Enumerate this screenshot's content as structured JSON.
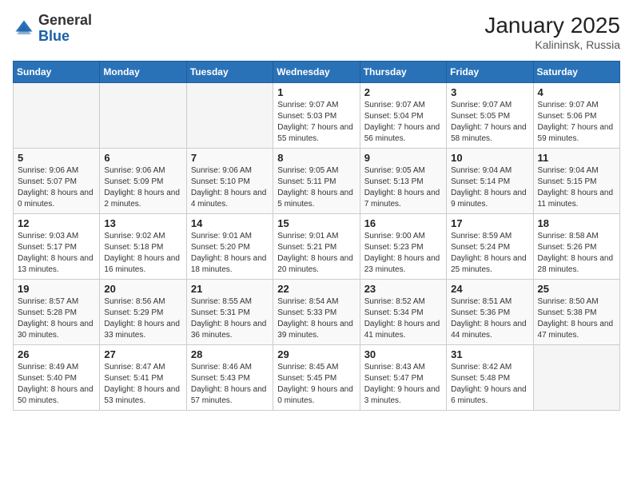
{
  "header": {
    "logo_general": "General",
    "logo_blue": "Blue",
    "month": "January 2025",
    "location": "Kalininsk, Russia"
  },
  "days_of_week": [
    "Sunday",
    "Monday",
    "Tuesday",
    "Wednesday",
    "Thursday",
    "Friday",
    "Saturday"
  ],
  "weeks": [
    [
      {
        "day": "",
        "info": ""
      },
      {
        "day": "",
        "info": ""
      },
      {
        "day": "",
        "info": ""
      },
      {
        "day": "1",
        "info": "Sunrise: 9:07 AM\nSunset: 5:03 PM\nDaylight: 7 hours and 55 minutes."
      },
      {
        "day": "2",
        "info": "Sunrise: 9:07 AM\nSunset: 5:04 PM\nDaylight: 7 hours and 56 minutes."
      },
      {
        "day": "3",
        "info": "Sunrise: 9:07 AM\nSunset: 5:05 PM\nDaylight: 7 hours and 58 minutes."
      },
      {
        "day": "4",
        "info": "Sunrise: 9:07 AM\nSunset: 5:06 PM\nDaylight: 7 hours and 59 minutes."
      }
    ],
    [
      {
        "day": "5",
        "info": "Sunrise: 9:06 AM\nSunset: 5:07 PM\nDaylight: 8 hours and 0 minutes."
      },
      {
        "day": "6",
        "info": "Sunrise: 9:06 AM\nSunset: 5:09 PM\nDaylight: 8 hours and 2 minutes."
      },
      {
        "day": "7",
        "info": "Sunrise: 9:06 AM\nSunset: 5:10 PM\nDaylight: 8 hours and 4 minutes."
      },
      {
        "day": "8",
        "info": "Sunrise: 9:05 AM\nSunset: 5:11 PM\nDaylight: 8 hours and 5 minutes."
      },
      {
        "day": "9",
        "info": "Sunrise: 9:05 AM\nSunset: 5:13 PM\nDaylight: 8 hours and 7 minutes."
      },
      {
        "day": "10",
        "info": "Sunrise: 9:04 AM\nSunset: 5:14 PM\nDaylight: 8 hours and 9 minutes."
      },
      {
        "day": "11",
        "info": "Sunrise: 9:04 AM\nSunset: 5:15 PM\nDaylight: 8 hours and 11 minutes."
      }
    ],
    [
      {
        "day": "12",
        "info": "Sunrise: 9:03 AM\nSunset: 5:17 PM\nDaylight: 8 hours and 13 minutes."
      },
      {
        "day": "13",
        "info": "Sunrise: 9:02 AM\nSunset: 5:18 PM\nDaylight: 8 hours and 16 minutes."
      },
      {
        "day": "14",
        "info": "Sunrise: 9:01 AM\nSunset: 5:20 PM\nDaylight: 8 hours and 18 minutes."
      },
      {
        "day": "15",
        "info": "Sunrise: 9:01 AM\nSunset: 5:21 PM\nDaylight: 8 hours and 20 minutes."
      },
      {
        "day": "16",
        "info": "Sunrise: 9:00 AM\nSunset: 5:23 PM\nDaylight: 8 hours and 23 minutes."
      },
      {
        "day": "17",
        "info": "Sunrise: 8:59 AM\nSunset: 5:24 PM\nDaylight: 8 hours and 25 minutes."
      },
      {
        "day": "18",
        "info": "Sunrise: 8:58 AM\nSunset: 5:26 PM\nDaylight: 8 hours and 28 minutes."
      }
    ],
    [
      {
        "day": "19",
        "info": "Sunrise: 8:57 AM\nSunset: 5:28 PM\nDaylight: 8 hours and 30 minutes."
      },
      {
        "day": "20",
        "info": "Sunrise: 8:56 AM\nSunset: 5:29 PM\nDaylight: 8 hours and 33 minutes."
      },
      {
        "day": "21",
        "info": "Sunrise: 8:55 AM\nSunset: 5:31 PM\nDaylight: 8 hours and 36 minutes."
      },
      {
        "day": "22",
        "info": "Sunrise: 8:54 AM\nSunset: 5:33 PM\nDaylight: 8 hours and 39 minutes."
      },
      {
        "day": "23",
        "info": "Sunrise: 8:52 AM\nSunset: 5:34 PM\nDaylight: 8 hours and 41 minutes."
      },
      {
        "day": "24",
        "info": "Sunrise: 8:51 AM\nSunset: 5:36 PM\nDaylight: 8 hours and 44 minutes."
      },
      {
        "day": "25",
        "info": "Sunrise: 8:50 AM\nSunset: 5:38 PM\nDaylight: 8 hours and 47 minutes."
      }
    ],
    [
      {
        "day": "26",
        "info": "Sunrise: 8:49 AM\nSunset: 5:40 PM\nDaylight: 8 hours and 50 minutes."
      },
      {
        "day": "27",
        "info": "Sunrise: 8:47 AM\nSunset: 5:41 PM\nDaylight: 8 hours and 53 minutes."
      },
      {
        "day": "28",
        "info": "Sunrise: 8:46 AM\nSunset: 5:43 PM\nDaylight: 8 hours and 57 minutes."
      },
      {
        "day": "29",
        "info": "Sunrise: 8:45 AM\nSunset: 5:45 PM\nDaylight: 9 hours and 0 minutes."
      },
      {
        "day": "30",
        "info": "Sunrise: 8:43 AM\nSunset: 5:47 PM\nDaylight: 9 hours and 3 minutes."
      },
      {
        "day": "31",
        "info": "Sunrise: 8:42 AM\nSunset: 5:48 PM\nDaylight: 9 hours and 6 minutes."
      },
      {
        "day": "",
        "info": ""
      }
    ]
  ]
}
